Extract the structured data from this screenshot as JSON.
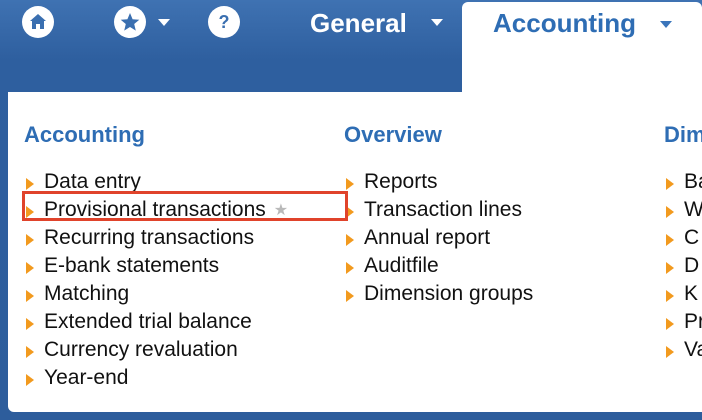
{
  "topnav": {
    "home_icon": "home-icon",
    "favorites_icon": "star-icon",
    "help_icon": "help-icon",
    "general_label": "General",
    "active_tab_label": "Accounting"
  },
  "menu": {
    "columns": [
      {
        "title": "Accounting",
        "items": [
          "Data entry",
          "Provisional transactions",
          "Recurring transactions",
          "E-bank statements",
          "Matching",
          "Extended trial balance",
          "Currency revaluation",
          "Year-end"
        ]
      },
      {
        "title": "Overview",
        "items": [
          "Reports",
          "Transaction lines",
          "Annual report",
          "Auditfile",
          "Dimension groups"
        ]
      },
      {
        "title": "Dim",
        "items": [
          "Ba",
          "W",
          "C",
          "D",
          "K",
          "Pr",
          "Va"
        ]
      }
    ],
    "highlighted_item": "Provisional transactions",
    "favorite_icon": "star-icon"
  },
  "colors": {
    "topbar": "#2e5f9f",
    "heading": "#2e6db4",
    "bullet": "#f29a1e",
    "highlight_border": "#e0432b"
  }
}
